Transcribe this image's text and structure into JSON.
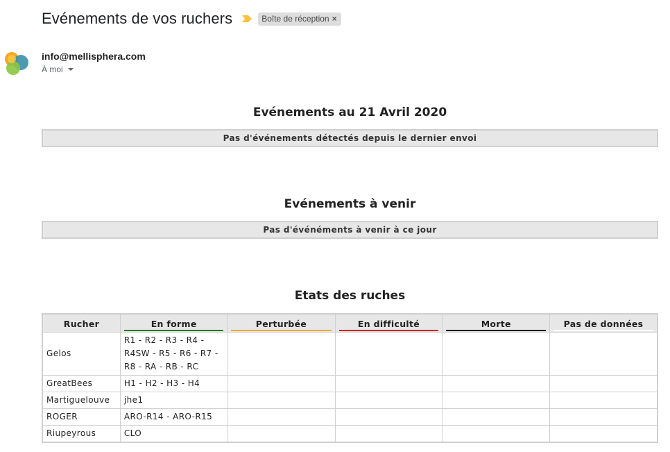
{
  "email": {
    "subject": "Evénements de vos ruchers",
    "label": "Boîte de réception",
    "label_remove": "×",
    "sender": "info@mellisphera.com",
    "to": "À moi"
  },
  "sections": {
    "events_title": "Evénements au 21 Avril 2020",
    "events_message": "Pas d'événements détectés depuis le dernier envoi",
    "upcoming_title": "Evénements à venir",
    "upcoming_message": "Pas d'événéments à venir à ce jour",
    "states_title": "Etats des ruches"
  },
  "table": {
    "headers": [
      {
        "label": "Rucher",
        "underline": ""
      },
      {
        "label": "En forme",
        "underline": "#1e7e1e"
      },
      {
        "label": "Perturbée",
        "underline": "#f0a830"
      },
      {
        "label": "En difficulté",
        "underline": "#d32020"
      },
      {
        "label": "Morte",
        "underline": "#111111"
      },
      {
        "label": "Pas de données",
        "underline": "#ffffff"
      }
    ],
    "rows": [
      {
        "rucher": "Gelos",
        "en_forme": [
          "R1 - R2 - R3 - R4 -",
          "R4SW - R5 - R6 - R7 -",
          "R8 - RA - RB - RC"
        ],
        "perturbee": "",
        "en_difficulte": "",
        "morte": "",
        "pas_de_donnees": ""
      },
      {
        "rucher": "GreatBees",
        "en_forme": [
          "H1 - H2 - H3 - H4"
        ],
        "perturbee": "",
        "en_difficulte": "",
        "morte": "",
        "pas_de_donnees": ""
      },
      {
        "rucher": "Martiguelouve",
        "en_forme": [
          "jhe1"
        ],
        "perturbee": "",
        "en_difficulte": "",
        "morte": "",
        "pas_de_donnees": ""
      },
      {
        "rucher": "ROGER",
        "en_forme": [
          "ARO-R14 - ARO-R15"
        ],
        "perturbee": "",
        "en_difficulte": "",
        "morte": "",
        "pas_de_donnees": ""
      },
      {
        "rucher": "Riupeyrous",
        "en_forme": [
          "CLO"
        ],
        "perturbee": "",
        "en_difficulte": "",
        "morte": "",
        "pas_de_donnees": ""
      }
    ]
  },
  "colors": {
    "importance_marker": "#f5c242",
    "label_bg": "#dddddd"
  }
}
